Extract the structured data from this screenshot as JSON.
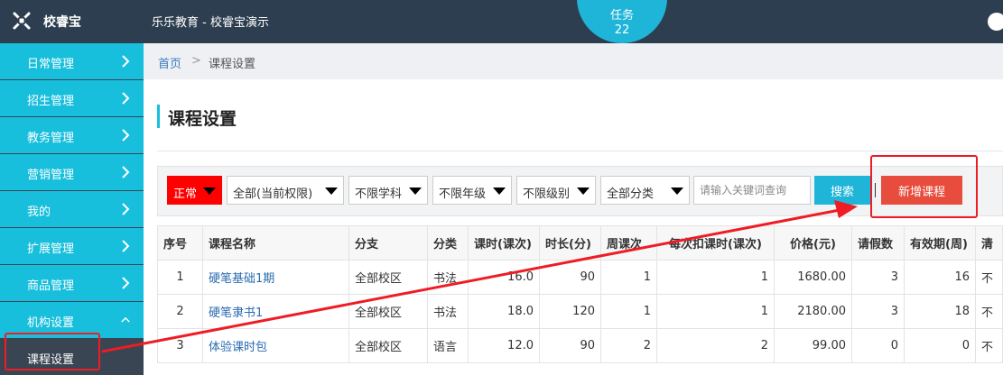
{
  "app": {
    "logo_text": "校睿宝",
    "org_title": "乐乐教育 - 校睿宝演示",
    "task_label": "任务",
    "task_count": "22"
  },
  "sidebar": {
    "items": [
      {
        "label": "日常管理"
      },
      {
        "label": "招生管理"
      },
      {
        "label": "教务管理"
      },
      {
        "label": "营销管理"
      },
      {
        "label": "我的"
      },
      {
        "label": "扩展管理"
      },
      {
        "label": "商品管理"
      },
      {
        "label": "机构设置"
      }
    ],
    "sub_item": "课程设置"
  },
  "breadcrumb": {
    "home": "首页",
    "sep": ">",
    "current": "课程设置"
  },
  "page_title": "课程设置",
  "filters": {
    "status": "正常",
    "campus": "全部(当前权限)",
    "subject": "不限学科",
    "grade": "不限年级",
    "level": "不限级别",
    "category": "全部分类",
    "search_placeholder": "请输入关键词查询",
    "search_label": "搜索",
    "add_label": "新增课程"
  },
  "colors": {
    "sidebar_item": "#18bfdc",
    "topbar": "#2d3e50",
    "add_button": "#e74c3c",
    "annotation": "#ee1c24"
  },
  "table": {
    "headers": [
      "序号",
      "课程名称",
      "分支",
      "分类",
      "课时(课次)",
      "时长(分)",
      "周课次",
      "每次扣课时(课次)",
      "价格(元)",
      "请假数",
      "有效期(周)",
      "清"
    ],
    "rows": [
      [
        "1",
        "硬笔基础1期",
        "全部校区",
        "书法",
        "16.0",
        "90",
        "1",
        "1",
        "1680.00",
        "3",
        "16",
        "不"
      ],
      [
        "2",
        "硬笔隶书1",
        "全部校区",
        "书法",
        "18.0",
        "120",
        "1",
        "1",
        "2180.00",
        "3",
        "18",
        "不"
      ],
      [
        "3",
        "体验课时包",
        "全部校区",
        "语言",
        "12.0",
        "90",
        "2",
        "2",
        "99.00",
        "0",
        "0",
        "不"
      ]
    ]
  }
}
